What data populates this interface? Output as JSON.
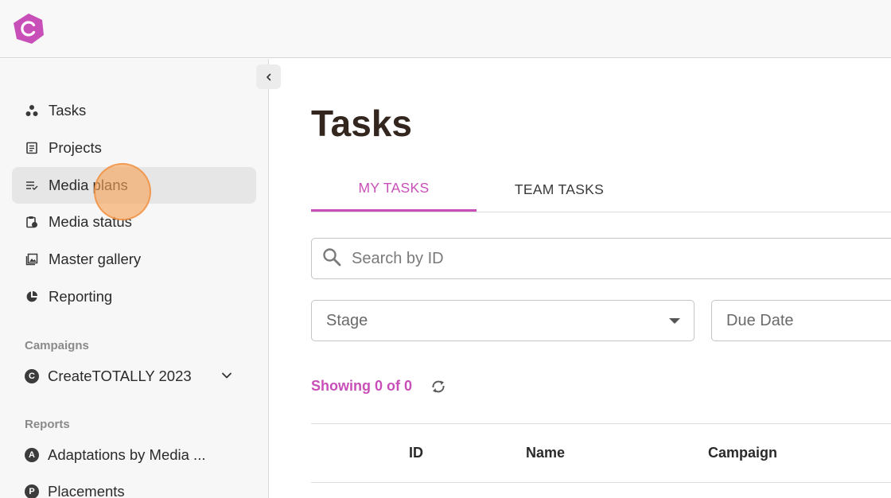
{
  "app": {
    "logo_color": "#c94fb8"
  },
  "sidebar": {
    "nav_items": [
      {
        "label": "Tasks",
        "icon": "tasks-icon"
      },
      {
        "label": "Projects",
        "icon": "projects-icon"
      },
      {
        "label": "Media plans",
        "icon": "media-plans-icon",
        "active": true
      },
      {
        "label": "Media status",
        "icon": "media-status-icon"
      },
      {
        "label": "Master gallery",
        "icon": "gallery-icon"
      },
      {
        "label": "Reporting",
        "icon": "reporting-icon"
      }
    ],
    "campaigns": {
      "section_label": "Campaigns",
      "items": [
        {
          "badge": "C",
          "label": "CreateTOTALLY 2023"
        }
      ]
    },
    "reports": {
      "section_label": "Reports",
      "items": [
        {
          "badge": "A",
          "label": "Adaptations by Media ..."
        },
        {
          "badge": "P",
          "label": "Placements"
        }
      ]
    }
  },
  "main": {
    "title": "Tasks",
    "tabs": [
      {
        "label": "MY TASKS",
        "active": true
      },
      {
        "label": "TEAM TASKS",
        "active": false
      }
    ],
    "search": {
      "placeholder": "Search by ID"
    },
    "filters": {
      "stage": {
        "placeholder": "Stage"
      },
      "due_date": {
        "placeholder": "Due Date"
      }
    },
    "showing_text": "Showing 0 of 0",
    "table": {
      "columns": [
        "ID",
        "Name",
        "Campaign"
      ]
    }
  },
  "colors": {
    "accent": "#c94fb8",
    "title": "#33261e"
  }
}
